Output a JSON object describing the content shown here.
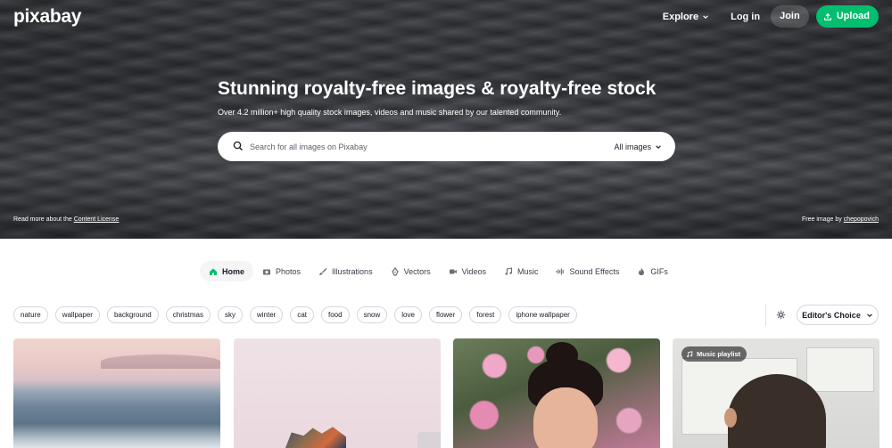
{
  "brand": {
    "logo": "pixabay"
  },
  "nav": {
    "explore": "Explore",
    "login": "Log in",
    "join": "Join",
    "upload": "Upload"
  },
  "hero": {
    "title": "Stunning royalty-free images & royalty-free stock",
    "subtitle": "Over 4.2 million+ high quality stock images, videos and music shared by our talented community.",
    "footer_left_prefix": "Read more about the ",
    "footer_left_link": "Content License",
    "footer_right_prefix": "Free image by ",
    "footer_right_link": "chepopovich"
  },
  "search": {
    "placeholder": "Search for all images on Pixabay",
    "filter": "All images"
  },
  "tabs": [
    {
      "label": "Home",
      "icon": "home-icon",
      "active": true
    },
    {
      "label": "Photos",
      "icon": "camera-icon"
    },
    {
      "label": "Illustrations",
      "icon": "brush-icon"
    },
    {
      "label": "Vectors",
      "icon": "pen-nib-icon"
    },
    {
      "label": "Videos",
      "icon": "video-camera-icon"
    },
    {
      "label": "Music",
      "icon": "music-note-icon"
    },
    {
      "label": "Sound Effects",
      "icon": "waveform-icon"
    },
    {
      "label": "GIFs",
      "icon": "flame-icon"
    }
  ],
  "chips": [
    "nature",
    "wallpaper",
    "background",
    "christmas",
    "sky",
    "winter",
    "cat",
    "food",
    "snow",
    "love",
    "flower",
    "forest",
    "iphone wallpaper"
  ],
  "sort": {
    "label": "Editor's Choice"
  },
  "gallery": {
    "badge": "Music playlist"
  },
  "colors": {
    "accent": "#02be6e",
    "text": "#191b26"
  }
}
